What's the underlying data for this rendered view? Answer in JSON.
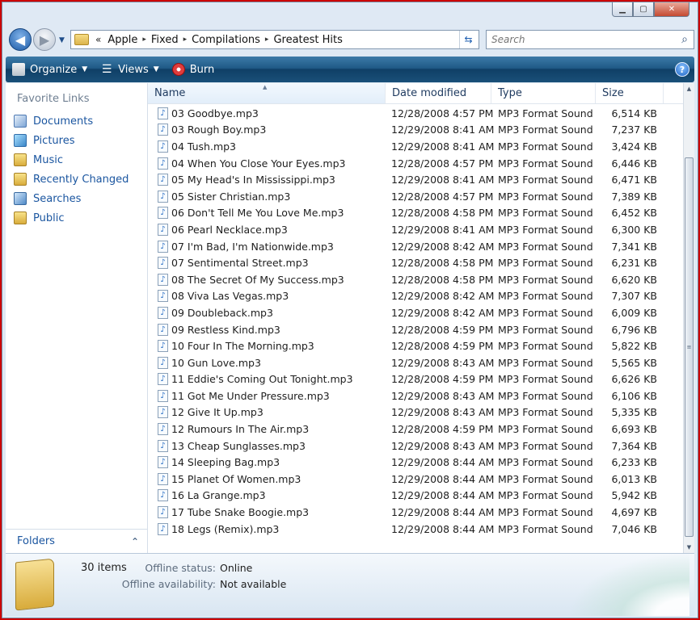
{
  "window": {
    "caption_buttons": {
      "minimize": "▁",
      "maximize": "▢",
      "close": "✕"
    }
  },
  "address": {
    "chevrons": "«",
    "crumbs": [
      "Apple",
      "Fixed",
      "Compilations",
      "Greatest Hits"
    ],
    "separator": "▸"
  },
  "search": {
    "placeholder": "Search"
  },
  "command_bar": {
    "organize": "Organize",
    "views": "Views",
    "burn": "Burn"
  },
  "nav": {
    "favorite_header": "Favorite Links",
    "favorites": [
      {
        "label": "Documents",
        "icon": "documents-icon"
      },
      {
        "label": "Pictures",
        "icon": "pictures-icon"
      },
      {
        "label": "Music",
        "icon": "music-folder-icon"
      },
      {
        "label": "Recently Changed",
        "icon": "recent-folder-icon"
      },
      {
        "label": "Searches",
        "icon": "searches-icon"
      },
      {
        "label": "Public",
        "icon": "public-folder-icon"
      }
    ],
    "folders_label": "Folders"
  },
  "columns": {
    "name": "Name",
    "date": "Date modified",
    "type": "Type",
    "size": "Size"
  },
  "files": [
    {
      "name": "03 Goodbye.mp3",
      "date": "12/28/2008 4:57 PM",
      "type": "MP3 Format Sound",
      "size": "6,514 KB"
    },
    {
      "name": "03 Rough Boy.mp3",
      "date": "12/29/2008 8:41 AM",
      "type": "MP3 Format Sound",
      "size": "7,237 KB"
    },
    {
      "name": "04 Tush.mp3",
      "date": "12/29/2008 8:41 AM",
      "type": "MP3 Format Sound",
      "size": "3,424 KB"
    },
    {
      "name": "04 When You Close Your Eyes.mp3",
      "date": "12/28/2008 4:57 PM",
      "type": "MP3 Format Sound",
      "size": "6,446 KB"
    },
    {
      "name": "05 My Head's In Mississippi.mp3",
      "date": "12/29/2008 8:41 AM",
      "type": "MP3 Format Sound",
      "size": "6,471 KB"
    },
    {
      "name": "05 Sister Christian.mp3",
      "date": "12/28/2008 4:57 PM",
      "type": "MP3 Format Sound",
      "size": "7,389 KB"
    },
    {
      "name": "06 Don't Tell Me You Love Me.mp3",
      "date": "12/28/2008 4:58 PM",
      "type": "MP3 Format Sound",
      "size": "6,452 KB"
    },
    {
      "name": "06 Pearl Necklace.mp3",
      "date": "12/29/2008 8:41 AM",
      "type": "MP3 Format Sound",
      "size": "6,300 KB"
    },
    {
      "name": "07 I'm Bad, I'm Nationwide.mp3",
      "date": "12/29/2008 8:42 AM",
      "type": "MP3 Format Sound",
      "size": "7,341 KB"
    },
    {
      "name": "07 Sentimental Street.mp3",
      "date": "12/28/2008 4:58 PM",
      "type": "MP3 Format Sound",
      "size": "6,231 KB"
    },
    {
      "name": "08 The Secret Of My Success.mp3",
      "date": "12/28/2008 4:58 PM",
      "type": "MP3 Format Sound",
      "size": "6,620 KB"
    },
    {
      "name": "08 Viva Las Vegas.mp3",
      "date": "12/29/2008 8:42 AM",
      "type": "MP3 Format Sound",
      "size": "7,307 KB"
    },
    {
      "name": "09 Doubleback.mp3",
      "date": "12/29/2008 8:42 AM",
      "type": "MP3 Format Sound",
      "size": "6,009 KB"
    },
    {
      "name": "09 Restless Kind.mp3",
      "date": "12/28/2008 4:59 PM",
      "type": "MP3 Format Sound",
      "size": "6,796 KB"
    },
    {
      "name": "10 Four In The Morning.mp3",
      "date": "12/28/2008 4:59 PM",
      "type": "MP3 Format Sound",
      "size": "5,822 KB"
    },
    {
      "name": "10 Gun Love.mp3",
      "date": "12/29/2008 8:43 AM",
      "type": "MP3 Format Sound",
      "size": "5,565 KB"
    },
    {
      "name": "11 Eddie's Coming Out Tonight.mp3",
      "date": "12/28/2008 4:59 PM",
      "type": "MP3 Format Sound",
      "size": "6,626 KB"
    },
    {
      "name": "11 Got Me Under Pressure.mp3",
      "date": "12/29/2008 8:43 AM",
      "type": "MP3 Format Sound",
      "size": "6,106 KB"
    },
    {
      "name": "12 Give It Up.mp3",
      "date": "12/29/2008 8:43 AM",
      "type": "MP3 Format Sound",
      "size": "5,335 KB"
    },
    {
      "name": "12 Rumours In The Air.mp3",
      "date": "12/28/2008 4:59 PM",
      "type": "MP3 Format Sound",
      "size": "6,693 KB"
    },
    {
      "name": "13 Cheap Sunglasses.mp3",
      "date": "12/29/2008 8:43 AM",
      "type": "MP3 Format Sound",
      "size": "7,364 KB"
    },
    {
      "name": "14 Sleeping Bag.mp3",
      "date": "12/29/2008 8:44 AM",
      "type": "MP3 Format Sound",
      "size": "6,233 KB"
    },
    {
      "name": "15 Planet Of Women.mp3",
      "date": "12/29/2008 8:44 AM",
      "type": "MP3 Format Sound",
      "size": "6,013 KB"
    },
    {
      "name": "16 La Grange.mp3",
      "date": "12/29/2008 8:44 AM",
      "type": "MP3 Format Sound",
      "size": "5,942 KB"
    },
    {
      "name": "17 Tube Snake Boogie.mp3",
      "date": "12/29/2008 8:44 AM",
      "type": "MP3 Format Sound",
      "size": "4,697 KB"
    },
    {
      "name": "18 Legs (Remix).mp3",
      "date": "12/29/2008 8:44 AM",
      "type": "MP3 Format Sound",
      "size": "7,046 KB"
    }
  ],
  "details": {
    "item_count": "30 items",
    "offline_status_label": "Offline status:",
    "offline_status_value": "Online",
    "offline_availability_label": "Offline availability:",
    "offline_availability_value": "Not available"
  },
  "colors": {
    "accent": "#1b56a0",
    "command_bar": "#1f5a86",
    "frame_border": "#cc0000"
  }
}
